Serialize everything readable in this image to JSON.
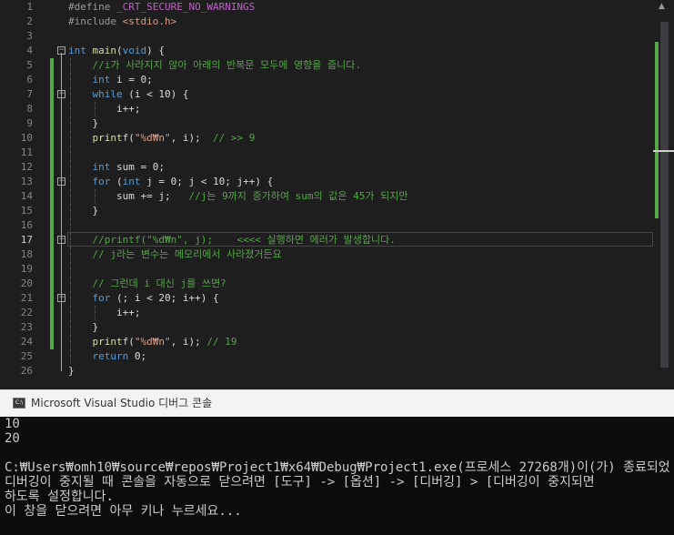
{
  "editor": {
    "current_line": 17,
    "colors": {
      "background": "#1e1e1e",
      "keyword": "#569cd6",
      "comment": "#57a64a",
      "string": "#d69d85",
      "change_bar": "#57a64a"
    },
    "lines": [
      {
        "n": "1",
        "tokens": [
          [
            "p",
            "#define "
          ],
          [
            "mac",
            "_CRT_SECURE_NO_WARNINGS"
          ]
        ]
      },
      {
        "n": "2",
        "tokens": [
          [
            "p",
            "#include "
          ],
          [
            "inc",
            "<stdio.h>"
          ]
        ]
      },
      {
        "n": "3",
        "tokens": []
      },
      {
        "n": "4",
        "fold": "collapse-icon",
        "tokens": [
          [
            "k",
            "int"
          ],
          [
            "t",
            " "
          ],
          [
            "f",
            "main"
          ],
          [
            "t",
            "("
          ],
          [
            "k",
            "void"
          ],
          [
            "t",
            ") {"
          ]
        ]
      },
      {
        "n": "5",
        "tokens": [
          [
            "t",
            "    "
          ],
          [
            "c",
            "//i가 사라지지 않아 아래의 반복문 모두에 영향을 줍니다."
          ]
        ]
      },
      {
        "n": "6",
        "tokens": [
          [
            "t",
            "    "
          ],
          [
            "k",
            "int"
          ],
          [
            "t",
            " i = 0;"
          ]
        ]
      },
      {
        "n": "7",
        "fold": "collapse-icon",
        "tokens": [
          [
            "t",
            "    "
          ],
          [
            "k",
            "while"
          ],
          [
            "t",
            " (i < 10) {"
          ]
        ]
      },
      {
        "n": "8",
        "tokens": [
          [
            "t",
            "        i++;"
          ]
        ]
      },
      {
        "n": "9",
        "tokens": [
          [
            "t",
            "    }"
          ]
        ]
      },
      {
        "n": "10",
        "tokens": [
          [
            "t",
            "    "
          ],
          [
            "f",
            "printf"
          ],
          [
            "t",
            "("
          ],
          [
            "s",
            "\"%d₩n\""
          ],
          [
            "t",
            ", i);  "
          ],
          [
            "c",
            "// >> 9"
          ]
        ]
      },
      {
        "n": "11",
        "tokens": []
      },
      {
        "n": "12",
        "tokens": [
          [
            "t",
            "    "
          ],
          [
            "k",
            "int"
          ],
          [
            "t",
            " sum = 0;"
          ]
        ]
      },
      {
        "n": "13",
        "fold": "collapse-icon",
        "tokens": [
          [
            "t",
            "    "
          ],
          [
            "k",
            "for"
          ],
          [
            "t",
            " ("
          ],
          [
            "k",
            "int"
          ],
          [
            "t",
            " j = 0; j < 10; j++) {"
          ]
        ]
      },
      {
        "n": "14",
        "tokens": [
          [
            "t",
            "        sum += j;   "
          ],
          [
            "c",
            "//j는 9까지 증가하여 sum의 값은 45가 되지만"
          ]
        ]
      },
      {
        "n": "15",
        "tokens": [
          [
            "t",
            "    }"
          ]
        ]
      },
      {
        "n": "16",
        "tokens": []
      },
      {
        "n": "17",
        "fold": "collapse-icon",
        "tokens": [
          [
            "t",
            "    "
          ],
          [
            "c",
            "//printf(\"%d₩n\", j);    <<<< 실행하면 에러가 발생합니다."
          ]
        ]
      },
      {
        "n": "18",
        "tokens": [
          [
            "t",
            "    "
          ],
          [
            "c",
            "// j라는 변수는 메모리에서 사라졌거든요"
          ]
        ]
      },
      {
        "n": "19",
        "tokens": []
      },
      {
        "n": "20",
        "tokens": [
          [
            "t",
            "    "
          ],
          [
            "c",
            "// 그런데 i 대신 j를 쓰면?"
          ]
        ]
      },
      {
        "n": "21",
        "fold": "collapse-icon",
        "tokens": [
          [
            "t",
            "    "
          ],
          [
            "k",
            "for"
          ],
          [
            "t",
            " (; i < 20; i++) {"
          ]
        ]
      },
      {
        "n": "22",
        "tokens": [
          [
            "t",
            "        i++;"
          ]
        ]
      },
      {
        "n": "23",
        "tokens": [
          [
            "t",
            "    }"
          ]
        ]
      },
      {
        "n": "24",
        "tokens": [
          [
            "t",
            "    "
          ],
          [
            "f",
            "printf"
          ],
          [
            "t",
            "("
          ],
          [
            "s",
            "\"%d₩n\""
          ],
          [
            "t",
            ", i); "
          ],
          [
            "c",
            "// 19"
          ]
        ]
      },
      {
        "n": "25",
        "tokens": [
          [
            "t",
            "    "
          ],
          [
            "k",
            "return"
          ],
          [
            "t",
            " 0;"
          ]
        ]
      },
      {
        "n": "26",
        "tokens": [
          [
            "t",
            "}"
          ]
        ]
      }
    ]
  },
  "console": {
    "title": "Microsoft Visual Studio 디버그 콘솔",
    "icon": "console-app-icon",
    "output": [
      "10",
      "20",
      "",
      "C:₩Users₩omh10₩source₩repos₩Project1₩x64₩Debug₩Project1.exe(프로세스 27268개)이(가) 종료되었",
      "디버깅이 중지될 때 콘솔을 자동으로 닫으려면 [도구] -> [옵션] -> [디버깅] > [디버깅이 중지되면",
      "하도록 설정합니다.",
      "이 창을 닫으려면 아무 키나 누르세요..."
    ]
  }
}
